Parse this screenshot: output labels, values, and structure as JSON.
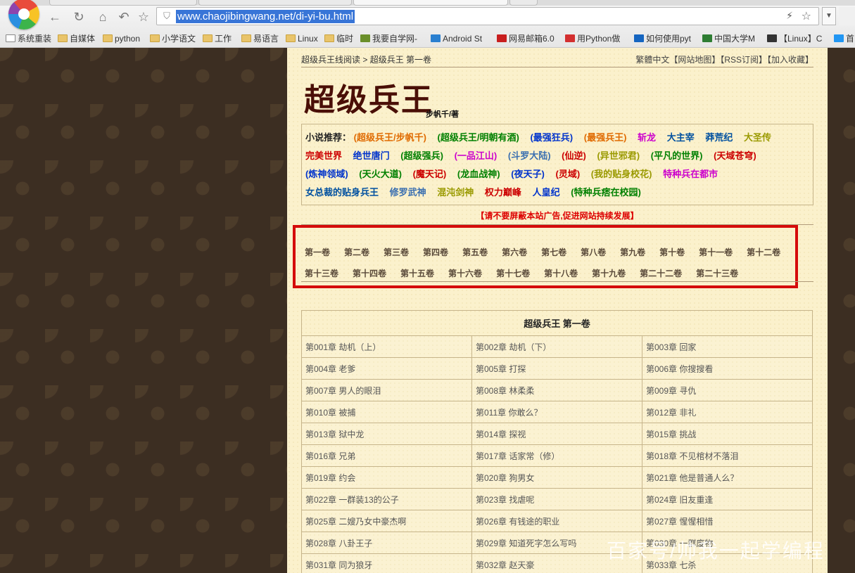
{
  "browser": {
    "url": "www.chaojibingwang.net/di-yi-bu.html",
    "bookmarks": [
      "系统重装",
      "自媒体",
      "python",
      "小学语文",
      "工作",
      "易语言",
      "Linux",
      "临时",
      "我要自学网-",
      "Android St",
      "网易邮箱6.0",
      "用Python做",
      "如何使用pyt",
      "中国大学M",
      "【Linux】C",
      "首"
    ]
  },
  "header": {
    "crumb_home": "超级兵王线阅读",
    "crumb_sep": " > ",
    "crumb_current": "超级兵王 第一卷",
    "top_links": "繁體中文【网站地图】【RSS订阅】【加入收藏】",
    "site_title": "超级兵王",
    "author": "步帆千/著"
  },
  "recommend": {
    "label": "小说推荐：",
    "items": [
      {
        "text": "(超级兵王/步帆千)",
        "color": "#e06a00"
      },
      {
        "text": "(超级兵王/明朝有酒)",
        "color": "#008000"
      },
      {
        "text": "(最强狂兵)",
        "color": "#0033cc"
      },
      {
        "text": "(最强兵王)",
        "color": "#e06a00"
      },
      {
        "text": "斩龙",
        "color": "#cc00cc"
      },
      {
        "text": "大主宰",
        "color": "#0050a0"
      },
      {
        "text": "莽荒纪",
        "color": "#0050a0"
      },
      {
        "text": "大圣传",
        "color": "#9a9a00"
      },
      {
        "text": "完美世界",
        "color": "#cc0000"
      },
      {
        "text": "绝世唐门",
        "color": "#0033cc"
      },
      {
        "text": "(超级强兵)",
        "color": "#008000"
      },
      {
        "text": "(一品江山)",
        "color": "#cc00cc"
      },
      {
        "text": "(斗罗大陆)",
        "color": "#3a6fb0"
      },
      {
        "text": "(仙逆)",
        "color": "#cc0000"
      },
      {
        "text": "(异世邪君)",
        "color": "#9a9a00"
      },
      {
        "text": "(平凡的世界)",
        "color": "#008000"
      },
      {
        "text": "(天域苍穹)",
        "color": "#cc0000"
      },
      {
        "text": "(炼神领域)",
        "color": "#0033cc"
      },
      {
        "text": "(天火大道)",
        "color": "#008000"
      },
      {
        "text": "(魔天记)",
        "color": "#cc0000"
      },
      {
        "text": "(龙血战神)",
        "color": "#008000"
      },
      {
        "text": "(夜天子)",
        "color": "#0033cc"
      },
      {
        "text": "(灵域)",
        "color": "#cc0000"
      },
      {
        "text": "(我的贴身校花)",
        "color": "#9a9a00"
      },
      {
        "text": "特种兵在都市",
        "color": "#cc00cc"
      },
      {
        "text": "女总裁的贴身兵王",
        "color": "#0050a0"
      },
      {
        "text": "修罗武神",
        "color": "#3a6fb0"
      },
      {
        "text": "混沌剑神",
        "color": "#9a9a00"
      },
      {
        "text": "权力巅峰",
        "color": "#cc0000"
      },
      {
        "text": "人皇纪",
        "color": "#0033cc"
      },
      {
        "text": "(特种兵痞在校园)",
        "color": "#008000"
      }
    ]
  },
  "ad_notice": "【请不要屏蔽本站广告,促进网站持续发展】",
  "volumes": [
    "第一卷",
    "第二卷",
    "第三卷",
    "第四卷",
    "第五卷",
    "第六卷",
    "第七卷",
    "第八卷",
    "第九卷",
    "第十卷",
    "第十一卷",
    "第十二卷",
    "第十三卷",
    "第十四卷",
    "第十五卷",
    "第十六卷",
    "第十七卷",
    "第十八卷",
    "第十九卷",
    "第二十二卷",
    "第二十三卷"
  ],
  "chapters": {
    "title": "超级兵王 第一卷",
    "rows": [
      [
        "第001章 劫机（上）",
        "第002章 劫机（下）",
        "第003章 回家"
      ],
      [
        "第004章 老爹",
        "第005章 打探",
        "第006章 你搜搜看"
      ],
      [
        "第007章 男人的眼泪",
        "第008章 林柔柔",
        "第009章 寻仇"
      ],
      [
        "第010章 被捕",
        "第011章 你敢么？",
        "第012章 非礼"
      ],
      [
        "第013章 狱中龙",
        "第014章 探视",
        "第015章 挑战"
      ],
      [
        "第016章 兄弟",
        "第017章 话家常（修）",
        "第018章 不见棺材不落泪"
      ],
      [
        "第019章 约会",
        "第020章 狗男女",
        "第021章 他是普通人么？"
      ],
      [
        "第022章 一群装13的公子",
        "第023章 找虐呢",
        "第024章 旧友重逢"
      ],
      [
        "第025章 二嫂乃女中豪杰啊",
        "第026章 有钱途的职业",
        "第027章 惺惺相惜"
      ],
      [
        "第028章 八卦王子",
        "第029章 知道死字怎么写吗",
        "第030章 一群废物"
      ],
      [
        "第031章 同为狼牙",
        "第032章 赵天豪",
        "第033章 七杀"
      ]
    ]
  },
  "watermark": "百家号/帅我一起学编程"
}
